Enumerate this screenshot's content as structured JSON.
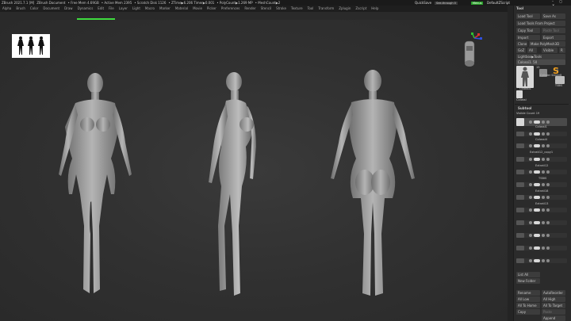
{
  "titlebar": {
    "app": "ZBrush 2021.7.1 [M]",
    "doc": "ZBrush Document",
    "free_mem": "• Free Mem 4.69GB",
    "active_mem": "• Active Mem 2395",
    "scratch": "• Scratch Disk 1126",
    "ztime": "• ZTime▶6.206 Timer▶0.001",
    "polycount": "• PolyCount▶1.269 MP",
    "meshcount": "• MeshCount▶2",
    "quicksave": "QuickSave",
    "see_through": "See-through 0",
    "menus": "Menus",
    "default_script": "DefaultZScript"
  },
  "menubar": [
    "Alpha",
    "Brush",
    "Color",
    "Document",
    "Draw",
    "Dynamics",
    "Edit",
    "File",
    "Layer",
    "Light",
    "Macro",
    "Marker",
    "Material",
    "Movie",
    "Picker",
    "Preferences",
    "Render",
    "Stencil",
    "Stroke",
    "Texture",
    "Tool",
    "Transform",
    "Zplugin",
    "Zscript",
    "Help"
  ],
  "topstrip": {
    "progress_fraction": 0.5
  },
  "sidebar": {
    "header": "Tool",
    "load_tool": "Load Tool",
    "save_as": "Save As",
    "load_from_project": "Load Tools From Project",
    "copy_tool": "Copy Tool",
    "paste_tool": "Paste Tool",
    "import": "Import",
    "export": "Export",
    "clone": "Clone",
    "make_polymesh": "Make PolyMesh3D",
    "goz": "GoZ",
    "all": "All",
    "visible": "Visible",
    "r": "R",
    "lightbox_tools": "Lightbox▶Tools",
    "active_tool_slider": "Colossi1. 50",
    "thumb_count_a": "15",
    "thumb_count_b": "2",
    "thumb_labels": [
      "Colossi1",
      "Cylinder SimpleB",
      "TSBIS"
    ],
    "thumb_label_bottom": "Colossi",
    "subtool_header": "Subtool",
    "visible_count": "Visible Count 19",
    "subtools": [
      "Colossi1",
      "Colossi4",
      "Extrati12_copy1",
      "Extrati12",
      "TSBIS",
      "Extrati18",
      "Extrati13"
    ],
    "list_all": "List All",
    "new_folder": "New Folder",
    "rename": "Rename",
    "autoreorder": "AutoReorder",
    "all_low": "All Low",
    "all_high": "All High",
    "all_to_home": "All To Home",
    "all_to_target": "All To Target",
    "copy": "Copy",
    "paste": "Paste",
    "append": "Append"
  },
  "colors": {
    "accent_green": "#3fdc3f",
    "viewport_bg": "#323232",
    "figure_fill": "#9a9a9a",
    "gizmo_red": "#e03030",
    "gizmo_green": "#30c030",
    "gizmo_blue": "#3050e0"
  }
}
